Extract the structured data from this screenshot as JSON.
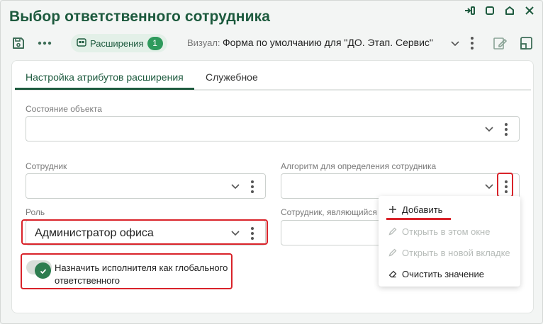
{
  "window": {
    "title": "Выбор ответственного сотрудника"
  },
  "toolbar": {
    "extensions_label": "Расширения",
    "extensions_count": "1",
    "view_label": "Визуал:",
    "view_value": "Форма по умолчанию для \"ДО. Этап. Сервис\""
  },
  "tabs": [
    {
      "label": "Настройка атрибутов расширения",
      "active": true
    },
    {
      "label": "Служебное",
      "active": false
    }
  ],
  "fields": {
    "object_state": {
      "label": "Состояние объекта",
      "value": ""
    },
    "employee": {
      "label": "Сотрудник",
      "value": ""
    },
    "algorithm": {
      "label": "Алгоритм для определения сотрудника",
      "value": ""
    },
    "role": {
      "label": "Роль",
      "value": "Администратор офиса"
    },
    "responsible_employee": {
      "label": "Сотрудник, являющийся о",
      "value": ""
    }
  },
  "toggle": {
    "label": "Назначить исполнителя как глобального ответственного",
    "on": true
  },
  "menu": {
    "items": [
      {
        "label": "Добавить",
        "icon": "plus-icon",
        "enabled": true
      },
      {
        "label": "Открыть в этом окне",
        "icon": "pencil-icon",
        "enabled": false
      },
      {
        "label": "Открыть в новой вкладке",
        "icon": "pencil-icon",
        "enabled": false
      },
      {
        "label": "Очистить значение",
        "icon": "eraser-icon",
        "enabled": true
      }
    ]
  },
  "colors": {
    "accent": "#1d5a3e",
    "highlight": "#d9232a",
    "badge": "#2e9a5c"
  }
}
